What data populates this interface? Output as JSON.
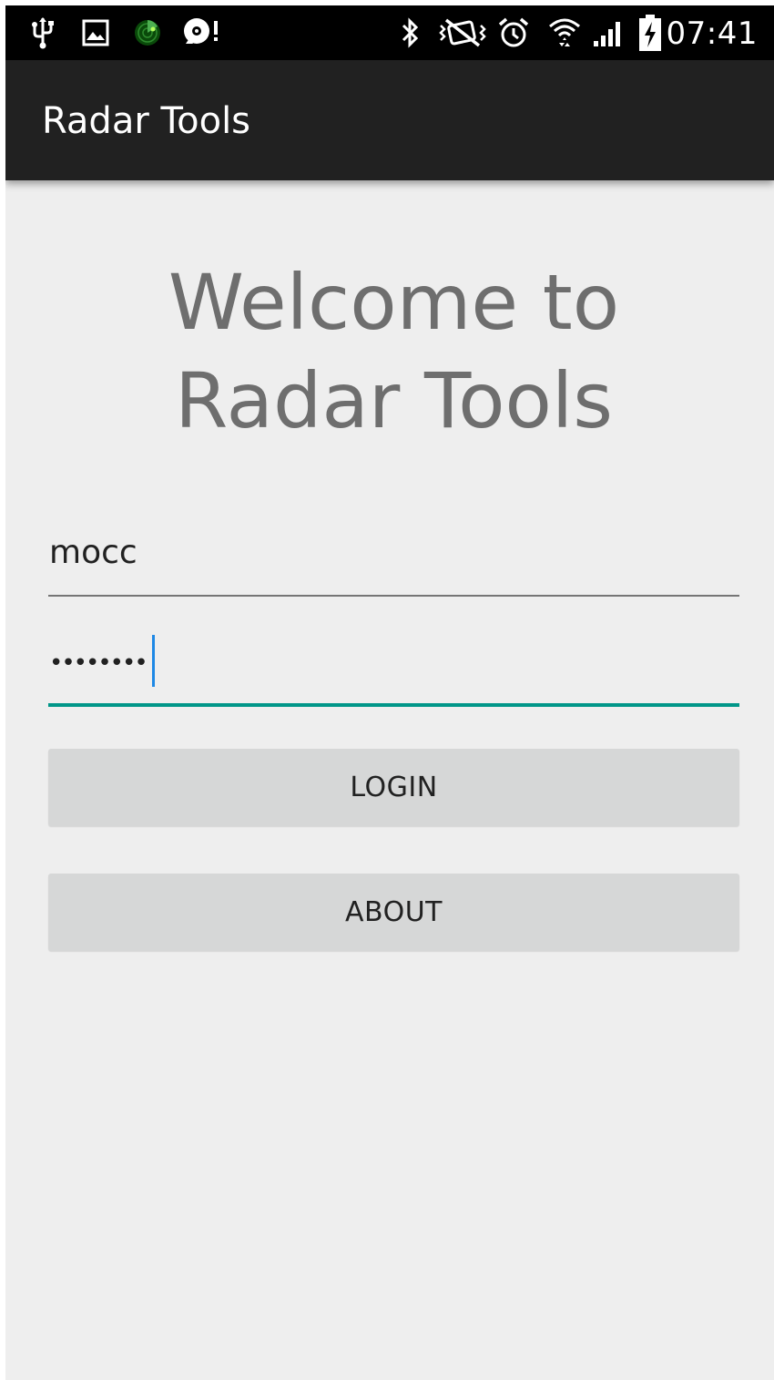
{
  "status_bar": {
    "time": "07:41",
    "left_icons": [
      "usb-icon",
      "image-icon",
      "radar-app-icon",
      "alert-disc-icon"
    ],
    "right_icons": [
      "bluetooth-icon",
      "nfc-icon",
      "alarm-icon",
      "wifi-icon",
      "signal-icon",
      "battery-charging-icon"
    ]
  },
  "action_bar": {
    "title": "Radar Tools"
  },
  "main": {
    "welcome_text": "Welcome to\nRadar Tools",
    "username": {
      "value": "mocc"
    },
    "password": {
      "value": "••••••••"
    },
    "login_label": "LOGIN",
    "about_label": "ABOUT"
  },
  "colors": {
    "background": "#eeeeee",
    "status_bar": "#000000",
    "action_bar": "#212121",
    "accent": "#009688",
    "cursor": "#1e88e5",
    "button": "#d6d7d7",
    "welcome_text": "#6e6e6e"
  }
}
